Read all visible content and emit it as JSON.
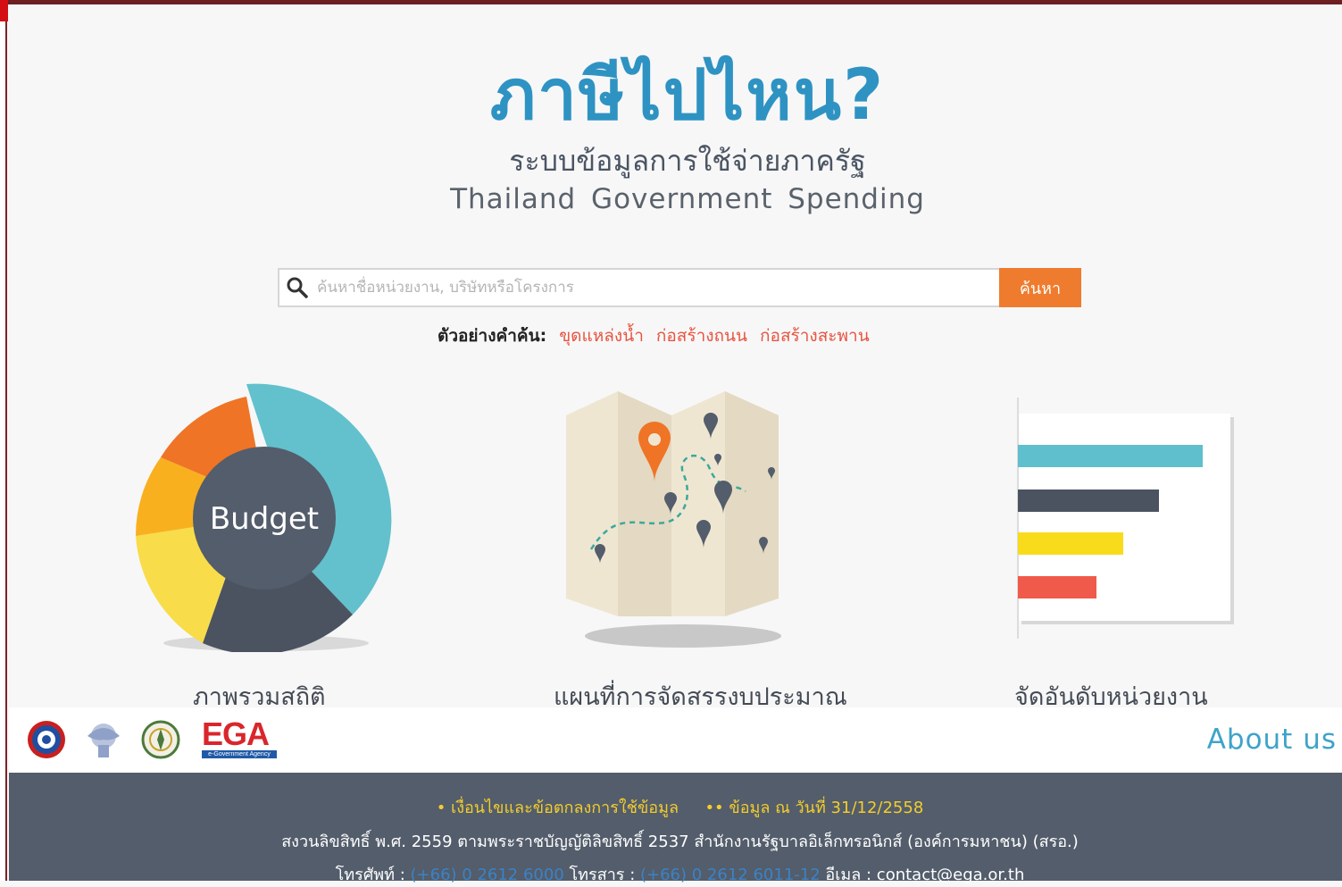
{
  "header": {
    "logo_title": "ภาษีไปไหน?",
    "subtitle_th": "ระบบข้อมูลการใช้จ่ายภาครัฐ",
    "subtitle_en": "Thailand Government Spending"
  },
  "search": {
    "placeholder": "ค้นหาชื่อหน่วยงาน, บริษัทหรือโครงการ",
    "button_label": "ค้นหา",
    "examples_label": "ตัวอย่างคำค้น:",
    "examples": [
      "ขุดแหล่งน้ำ",
      "ก่อสร้างถนน",
      "ก่อสร้างสะพาน"
    ]
  },
  "features": [
    {
      "icon": "budget-donut-icon",
      "center_label": "Budget",
      "caption": "ภาพรวมสถิติ"
    },
    {
      "icon": "budget-map-icon",
      "caption": "แผนที่การจัดสรรงบประมาณ"
    },
    {
      "icon": "ranking-bar-icon",
      "caption": "จัดอันดับหน่วยงาน"
    }
  ],
  "partners": {
    "logos": [
      "dga-logo",
      "garuda-emblem-logo",
      "government-seal-logo",
      "ega-logo"
    ],
    "ega_text": "EGA",
    "ega_subtext": "e-Government Agency"
  },
  "about_label": "About us",
  "footer": {
    "terms": "• เงื่อนไขและข้อตกลงการใช้ข้อมูล",
    "data_as_of": "•• ข้อมูล ณ วันที่ 31/12/2558",
    "copyright": "สงวนลิขสิทธิ์ พ.ศ. 2559 ตามพระราชบัญญัติลิขสิทธิ์ 2537 สำนักงานรัฐบาลอิเล็กทรอนิกส์ (องค์การมหาชน) (สรอ.)",
    "phone_label": "โทรศัพท์ :",
    "phone": "(+66) 0 2612 6000",
    "fax_label": "โทรสาร :",
    "fax": "(+66) 0 2612 6011-12",
    "email_label": "อีเมล :",
    "email": "contact@ega.or.th"
  },
  "colors": {
    "title_blue": "#2e93c2",
    "accent_orange": "#ef7c2e",
    "keyword_red": "#e8543f",
    "footer_bg": "#535d6b",
    "footer_yellow": "#f3cd2d"
  }
}
